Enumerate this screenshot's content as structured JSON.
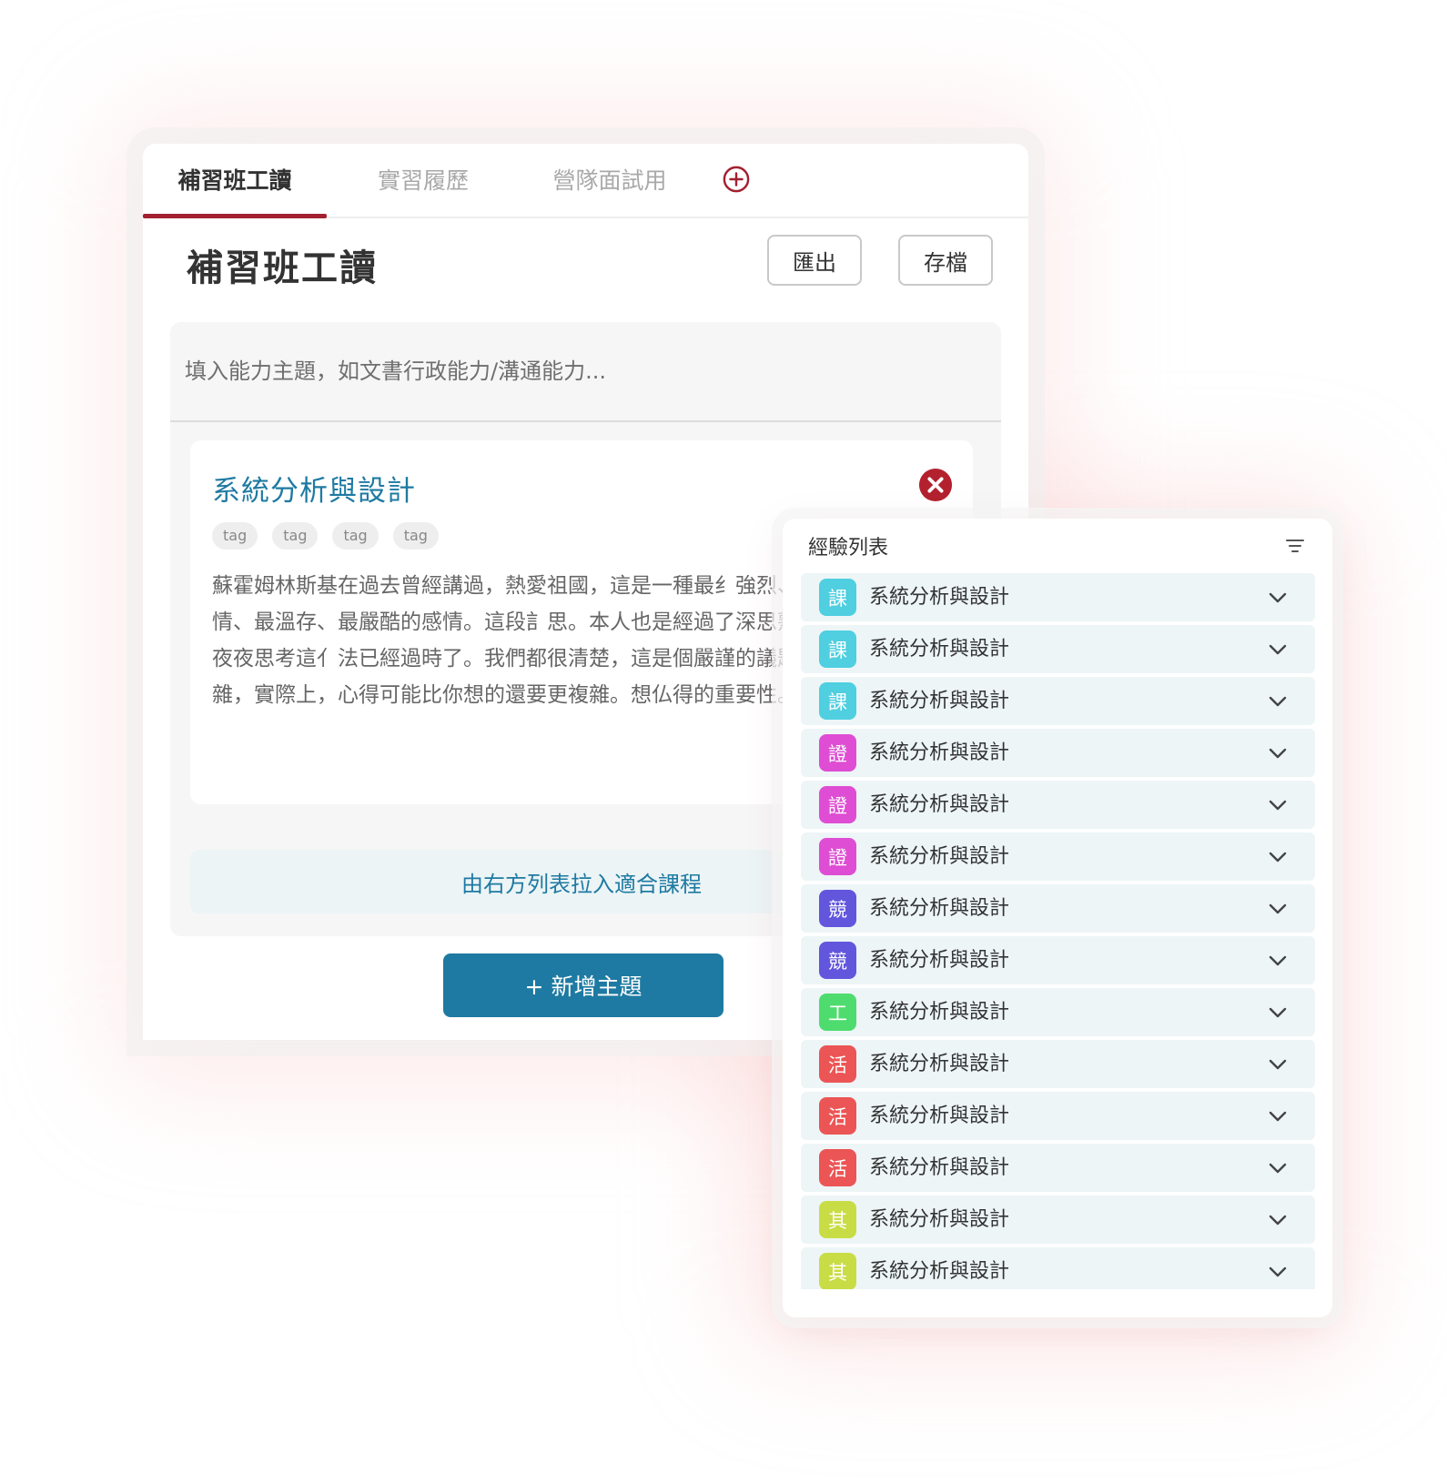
{
  "tabs": [
    {
      "label": "補習班工讀",
      "active": true
    },
    {
      "label": "實習履歷",
      "active": false
    },
    {
      "label": "營隊面試用",
      "active": false
    }
  ],
  "page": {
    "title": "補習班工讀",
    "export_label": "匯出",
    "save_label": "存檔"
  },
  "topic": {
    "placeholder": "填入能力主題，如文書行政能力/溝通能力..."
  },
  "card": {
    "title": "系統分析與設計",
    "tags": [
      "tag",
      "tag",
      "tag",
      "tag"
    ],
    "body": "蘇霍姆林斯基在過去曾經講過，熱愛祖國，這是一種最纟強烈、最溫柔、最無情、最溫存、最嚴酷的感情。這段訁思。本人也是經過了深思熟慮，在每個日日夜夜思考這亻法已經過時了。我們都很清楚，這是個嚴謹的議題。不要得很複雜，實際上，心得可能比你想的還要更複雜。想仏得的重要性。"
  },
  "drop_zone_label": "由右方列表拉入適合課程",
  "add_topic_label": "+ 新增主題",
  "colors": {
    "accent_red": "#a3202f",
    "primary_blue": "#1e7aa2",
    "close_red": "#b3212f"
  },
  "experience_list": {
    "title": "經驗列表",
    "items": [
      {
        "badge": "課",
        "color": "#4fcfe0",
        "label": "系統分析與設計"
      },
      {
        "badge": "課",
        "color": "#4fcfe0",
        "label": "系統分析與設計"
      },
      {
        "badge": "課",
        "color": "#4fcfe0",
        "label": "系統分析與設計"
      },
      {
        "badge": "證",
        "color": "#de4dd3",
        "label": "系統分析與設計"
      },
      {
        "badge": "證",
        "color": "#de4dd3",
        "label": "系統分析與設計"
      },
      {
        "badge": "證",
        "color": "#de4dd3",
        "label": "系統分析與設計"
      },
      {
        "badge": "競",
        "color": "#6256dd",
        "label": "系統分析與設計"
      },
      {
        "badge": "競",
        "color": "#6256dd",
        "label": "系統分析與設計"
      },
      {
        "badge": "工",
        "color": "#4fdc6f",
        "label": "系統分析與設計"
      },
      {
        "badge": "活",
        "color": "#ec5555",
        "label": "系統分析與設計"
      },
      {
        "badge": "活",
        "color": "#ec5555",
        "label": "系統分析與設計"
      },
      {
        "badge": "活",
        "color": "#ec5555",
        "label": "系統分析與設計"
      },
      {
        "badge": "其",
        "color": "#c8dd45",
        "label": "系統分析與設計"
      },
      {
        "badge": "其",
        "color": "#c8dd45",
        "label": "系統分析與設計"
      }
    ]
  }
}
